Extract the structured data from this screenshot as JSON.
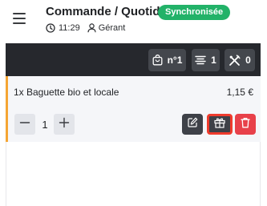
{
  "header": {
    "title": "Commande / Quotidien",
    "status_badge": "Synchronisée",
    "time": "11:29",
    "user_role": "Gérant"
  },
  "toolbar": {
    "order_number": "n°1",
    "lines_count": "1",
    "covers_count": "0"
  },
  "order_line": {
    "name": "1x Baguette bio et locale",
    "price": "1,15 €",
    "quantity": "1"
  },
  "icons": {
    "menu": "menu-icon",
    "clock": "clock-icon",
    "user": "user-icon",
    "order": "shopping-bag-icon",
    "lines": "list-icon",
    "covers": "cutlery-icon",
    "minus": "minus-icon",
    "plus": "plus-icon",
    "edit": "edit-icon",
    "gift": "gift-icon",
    "delete": "trash-icon"
  },
  "colors": {
    "sync_badge": "#22b268",
    "toolbar_bg": "#26282d",
    "chip_bg": "#44474d",
    "accent_left_border": "#f5a533",
    "gift_highlight": "#ef3b2d",
    "delete_button": "#e8414a"
  }
}
